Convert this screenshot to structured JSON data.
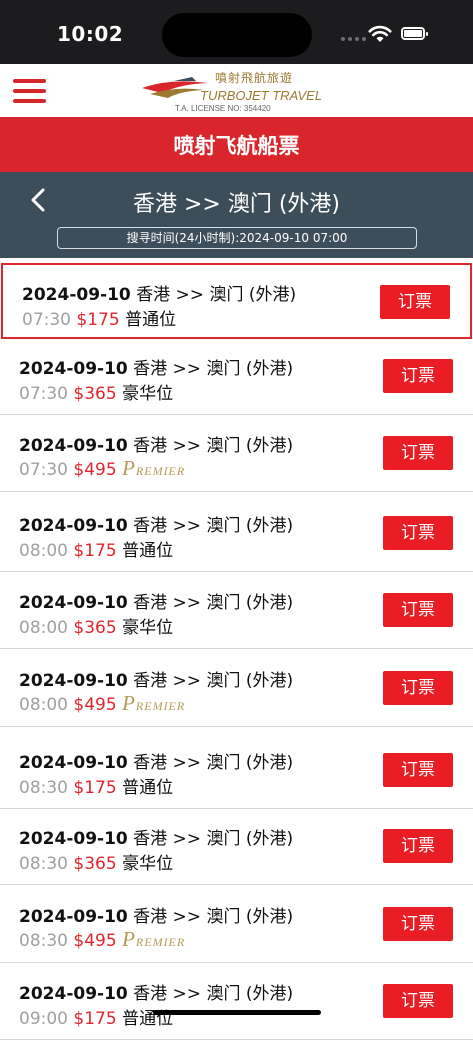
{
  "status_bar": {
    "time": "10:02"
  },
  "header": {
    "logo_cn": "噴射飛航旅遊",
    "logo_en": "TURBOJET TRAVEL",
    "license": "T.A. LICENSE NO: 354420"
  },
  "title_bar": {
    "title": "喷射飞航船票"
  },
  "route_bar": {
    "title": "香港 >> 澳门 (外港)",
    "search_time": "搜寻时间(24小时制):2024-09-10 07:00"
  },
  "book_label": "订票",
  "trips": [
    {
      "date": "2024-09-10",
      "route": "香港 >> 澳门 (外港)",
      "time": "07:30",
      "price": "$175",
      "class": "普通位",
      "premier": false,
      "selected": true
    },
    {
      "date": "2024-09-10",
      "route": "香港 >> 澳门 (外港)",
      "time": "07:30",
      "price": "$365",
      "class": "豪华位",
      "premier": false,
      "selected": false
    },
    {
      "date": "2024-09-10",
      "route": "香港 >> 澳门 (外港)",
      "time": "07:30",
      "price": "$495",
      "class": "Premier",
      "premier": true,
      "selected": false
    },
    {
      "date": "2024-09-10",
      "route": "香港 >> 澳门 (外港)",
      "time": "08:00",
      "price": "$175",
      "class": "普通位",
      "premier": false,
      "selected": false
    },
    {
      "date": "2024-09-10",
      "route": "香港 >> 澳门 (外港)",
      "time": "08:00",
      "price": "$365",
      "class": "豪华位",
      "premier": false,
      "selected": false
    },
    {
      "date": "2024-09-10",
      "route": "香港 >> 澳门 (外港)",
      "time": "08:00",
      "price": "$495",
      "class": "Premier",
      "premier": true,
      "selected": false
    },
    {
      "date": "2024-09-10",
      "route": "香港 >> 澳门 (外港)",
      "time": "08:30",
      "price": "$175",
      "class": "普通位",
      "premier": false,
      "selected": false
    },
    {
      "date": "2024-09-10",
      "route": "香港 >> 澳门 (外港)",
      "time": "08:30",
      "price": "$365",
      "class": "豪华位",
      "premier": false,
      "selected": false
    },
    {
      "date": "2024-09-10",
      "route": "香港 >> 澳门 (外港)",
      "time": "08:30",
      "price": "$495",
      "class": "Premier",
      "premier": true,
      "selected": false
    },
    {
      "date": "2024-09-10",
      "route": "香港 >> 澳门 (外港)",
      "time": "09:00",
      "price": "$175",
      "class": "普通位",
      "premier": false,
      "selected": false
    }
  ],
  "colors": {
    "brand_red": "#d9262c",
    "route_bar": "#3d4e5b",
    "price_red": "#e0262c",
    "premier_gold": "#b49a55"
  }
}
